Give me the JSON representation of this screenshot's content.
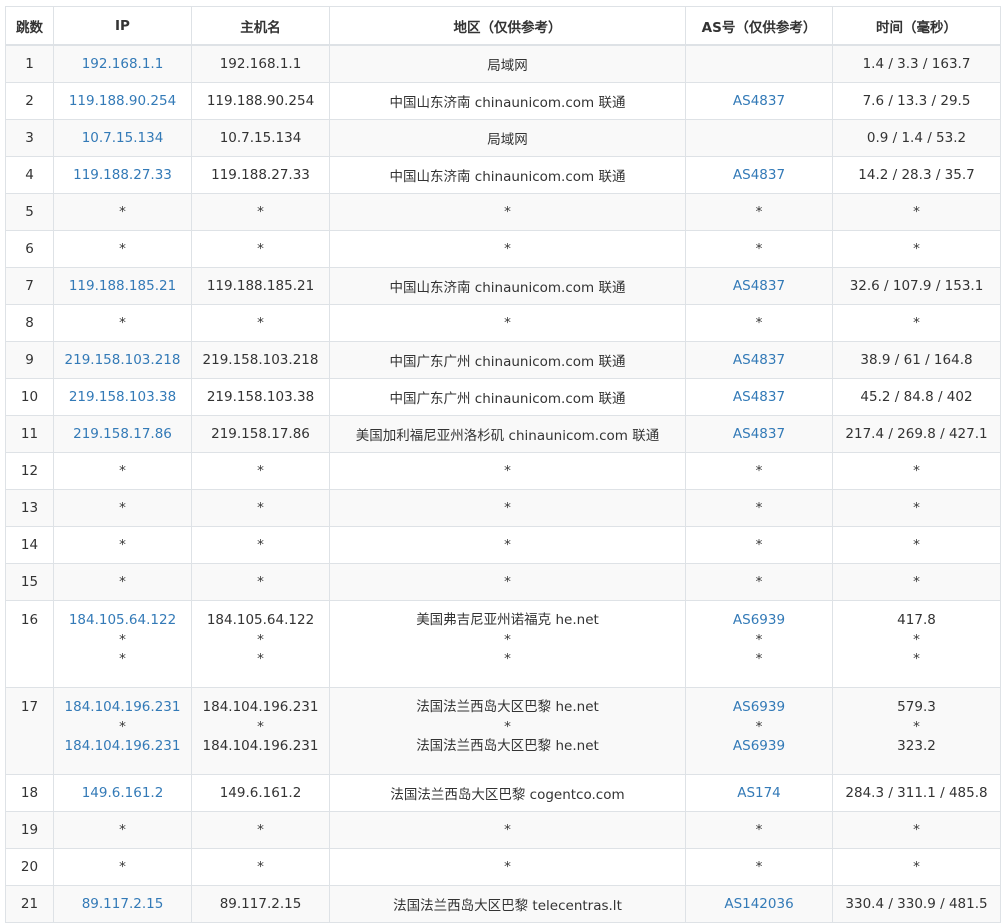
{
  "headers": {
    "hop": "跳数",
    "ip": "IP",
    "host": "主机名",
    "location": "地区（仅供参考）",
    "asn": "AS号（仅供参考）",
    "time": "时间（毫秒）"
  },
  "rows": [
    {
      "hop": "1",
      "ip": [
        "192.168.1.1"
      ],
      "host": [
        "192.168.1.1"
      ],
      "location": [
        "局域网"
      ],
      "asn": [
        ""
      ],
      "time": [
        "1.4 / 3.3 / 163.7"
      ]
    },
    {
      "hop": "2",
      "ip": [
        "119.188.90.254"
      ],
      "host": [
        "119.188.90.254"
      ],
      "location": [
        "中国山东济南 chinaunicom.com 联通"
      ],
      "asn": [
        "AS4837"
      ],
      "time": [
        "7.6 / 13.3 / 29.5"
      ]
    },
    {
      "hop": "3",
      "ip": [
        "10.7.15.134"
      ],
      "host": [
        "10.7.15.134"
      ],
      "location": [
        "局域网"
      ],
      "asn": [
        ""
      ],
      "time": [
        "0.9 / 1.4 / 53.2"
      ]
    },
    {
      "hop": "4",
      "ip": [
        "119.188.27.33"
      ],
      "host": [
        "119.188.27.33"
      ],
      "location": [
        "中国山东济南 chinaunicom.com 联通"
      ],
      "asn": [
        "AS4837"
      ],
      "time": [
        "14.2 / 28.3 / 35.7"
      ]
    },
    {
      "hop": "5",
      "ip": [
        "*"
      ],
      "host": [
        "*"
      ],
      "location": [
        "*"
      ],
      "asn": [
        "*"
      ],
      "time": [
        "*"
      ]
    },
    {
      "hop": "6",
      "ip": [
        "*"
      ],
      "host": [
        "*"
      ],
      "location": [
        "*"
      ],
      "asn": [
        "*"
      ],
      "time": [
        "*"
      ]
    },
    {
      "hop": "7",
      "ip": [
        "119.188.185.21"
      ],
      "host": [
        "119.188.185.21"
      ],
      "location": [
        "中国山东济南 chinaunicom.com 联通"
      ],
      "asn": [
        "AS4837"
      ],
      "time": [
        "32.6 / 107.9 / 153.1"
      ]
    },
    {
      "hop": "8",
      "ip": [
        "*"
      ],
      "host": [
        "*"
      ],
      "location": [
        "*"
      ],
      "asn": [
        "*"
      ],
      "time": [
        "*"
      ]
    },
    {
      "hop": "9",
      "ip": [
        "219.158.103.218"
      ],
      "host": [
        "219.158.103.218"
      ],
      "location": [
        "中国广东广州 chinaunicom.com 联通"
      ],
      "asn": [
        "AS4837"
      ],
      "time": [
        "38.9 / 61 / 164.8"
      ]
    },
    {
      "hop": "10",
      "ip": [
        "219.158.103.38"
      ],
      "host": [
        "219.158.103.38"
      ],
      "location": [
        "中国广东广州 chinaunicom.com 联通"
      ],
      "asn": [
        "AS4837"
      ],
      "time": [
        "45.2 / 84.8 / 402"
      ]
    },
    {
      "hop": "11",
      "ip": [
        "219.158.17.86"
      ],
      "host": [
        "219.158.17.86"
      ],
      "location": [
        "美国加利福尼亚州洛杉矶 chinaunicom.com 联通"
      ],
      "asn": [
        "AS4837"
      ],
      "time": [
        "217.4 / 269.8 / 427.1"
      ]
    },
    {
      "hop": "12",
      "ip": [
        "*"
      ],
      "host": [
        "*"
      ],
      "location": [
        "*"
      ],
      "asn": [
        "*"
      ],
      "time": [
        "*"
      ]
    },
    {
      "hop": "13",
      "ip": [
        "*"
      ],
      "host": [
        "*"
      ],
      "location": [
        "*"
      ],
      "asn": [
        "*"
      ],
      "time": [
        "*"
      ]
    },
    {
      "hop": "14",
      "ip": [
        "*"
      ],
      "host": [
        "*"
      ],
      "location": [
        "*"
      ],
      "asn": [
        "*"
      ],
      "time": [
        "*"
      ]
    },
    {
      "hop": "15",
      "ip": [
        "*"
      ],
      "host": [
        "*"
      ],
      "location": [
        "*"
      ],
      "asn": [
        "*"
      ],
      "time": [
        "*"
      ]
    },
    {
      "hop": "16",
      "ip": [
        "184.105.64.122",
        "*",
        "*"
      ],
      "host": [
        "184.105.64.122",
        "*",
        "*"
      ],
      "location": [
        "美国弗吉尼亚州诺福克 he.net",
        "*",
        "*"
      ],
      "asn": [
        "AS6939",
        "*",
        "*"
      ],
      "time": [
        "417.8",
        "*",
        "*"
      ]
    },
    {
      "hop": "17",
      "ip": [
        "184.104.196.231",
        "*",
        "184.104.196.231"
      ],
      "host": [
        "184.104.196.231",
        "*",
        "184.104.196.231"
      ],
      "location": [
        "法国法兰西岛大区巴黎 he.net",
        "*",
        "法国法兰西岛大区巴黎 he.net"
      ],
      "asn": [
        "AS6939",
        "*",
        "AS6939"
      ],
      "time": [
        "579.3",
        "*",
        "323.2"
      ]
    },
    {
      "hop": "18",
      "ip": [
        "149.6.161.2"
      ],
      "host": [
        "149.6.161.2"
      ],
      "location": [
        "法国法兰西岛大区巴黎 cogentco.com"
      ],
      "asn": [
        "AS174"
      ],
      "time": [
        "284.3 / 311.1 / 485.8"
      ]
    },
    {
      "hop": "19",
      "ip": [
        "*"
      ],
      "host": [
        "*"
      ],
      "location": [
        "*"
      ],
      "asn": [
        "*"
      ],
      "time": [
        "*"
      ]
    },
    {
      "hop": "20",
      "ip": [
        "*"
      ],
      "host": [
        "*"
      ],
      "location": [
        "*"
      ],
      "asn": [
        "*"
      ],
      "time": [
        "*"
      ]
    },
    {
      "hop": "21",
      "ip": [
        "89.117.2.15"
      ],
      "host": [
        "89.117.2.15"
      ],
      "location": [
        "法国法兰西岛大区巴黎 telecentras.lt"
      ],
      "asn": [
        "AS142036"
      ],
      "time": [
        "330.4 / 330.9 / 481.5"
      ]
    }
  ],
  "colors": {
    "link": "#337ab7",
    "text": "#333333",
    "stripe": "#f9f9f9",
    "border": "#dee2e6"
  }
}
